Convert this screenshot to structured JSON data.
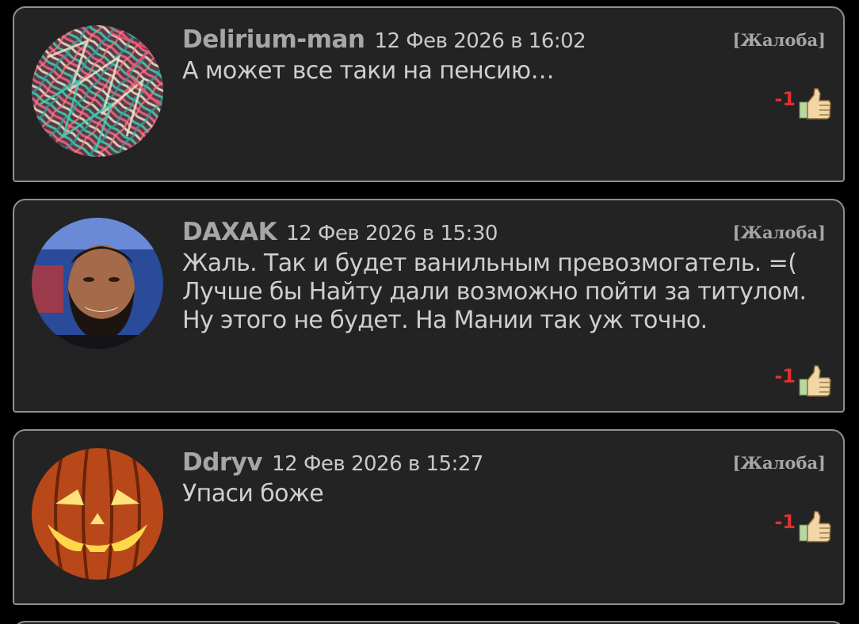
{
  "comments": [
    {
      "username": "Delirium-man",
      "timestamp": "12 Фев 2026 в 16:02",
      "report_label": "[Жалоба]",
      "text": "А может все таки на пенсию…",
      "score": "-1",
      "avatar_icon": "abstract-pattern-avatar",
      "vote_icon": "thumbs-up-icon"
    },
    {
      "username": "DAXAK",
      "timestamp": "12 Фев 2026 в 15:30",
      "report_label": "[Жалоба]",
      "text": "Жаль. Так и будет ванильным превозмогатель. =( Лучше бы Найту дали возможно пойти за титулом. Ну этого не будет. На Мании так уж точно.",
      "score": "-1",
      "avatar_icon": "wrestler-photo-avatar",
      "vote_icon": "thumbs-up-icon"
    },
    {
      "username": "Ddryv",
      "timestamp": "12 Фев 2026 в 15:27",
      "report_label": "[Жалоба]",
      "text": "Упаси боже",
      "score": "-1",
      "avatar_icon": "pumpkin-avatar",
      "vote_icon": "thumbs-up-icon"
    }
  ],
  "colors": {
    "page_background": "#000000",
    "card_background": "#232323",
    "card_border": "#8f8f8f",
    "username": "#a6a6a6",
    "text": "#cfcfcf",
    "negative_score": "#e03030"
  }
}
